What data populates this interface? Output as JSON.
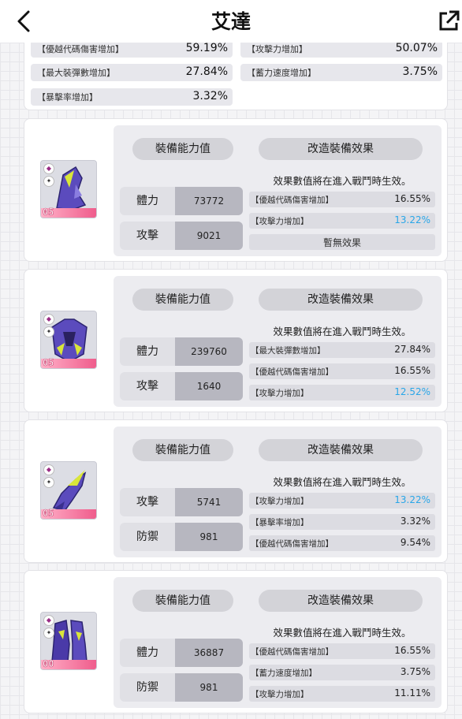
{
  "header": {
    "title": "艾達",
    "back_icon": "chevron-left-icon",
    "share_icon": "external-link-icon"
  },
  "summary": [
    {
      "label": "【優越代碼傷害增加】",
      "value": "59.19%"
    },
    {
      "label": "【攻擊力增加】",
      "value": "50.07%"
    },
    {
      "label": "【最大裝彈數增加】",
      "value": "27.84%"
    },
    {
      "label": "【蓄力速度增加】",
      "value": "3.75%"
    },
    {
      "label": "【暴擊率增加】",
      "value": "3.32%"
    }
  ],
  "ui": {
    "stats_pill": "裝備能力值",
    "effects_pill": "改造裝備效果",
    "effect_note": "效果數值將在進入戰鬥時生效。",
    "none_text": "暫無效果"
  },
  "cards": [
    {
      "level": "05",
      "stats": [
        {
          "key": "體力",
          "value": "73772"
        },
        {
          "key": "攻擊",
          "value": "9021"
        }
      ],
      "effects": [
        {
          "label": "【優越代碼傷害增加】",
          "value": "16.55%",
          "highlight": false
        },
        {
          "label": "【攻擊力增加】",
          "value": "13.22%",
          "highlight": true
        }
      ]
    },
    {
      "level": "05",
      "stats": [
        {
          "key": "體力",
          "value": "239760"
        },
        {
          "key": "攻擊",
          "value": "1640"
        }
      ],
      "effects": [
        {
          "label": "【最大裝彈數增加】",
          "value": "27.84%",
          "highlight": false
        },
        {
          "label": "【優越代碼傷害增加】",
          "value": "16.55%",
          "highlight": false
        },
        {
          "label": "【攻擊力增加】",
          "value": "12.52%",
          "highlight": true
        }
      ]
    },
    {
      "level": "05",
      "stats": [
        {
          "key": "攻擊",
          "value": "5741"
        },
        {
          "key": "防禦",
          "value": "981"
        }
      ],
      "effects": [
        {
          "label": "【攻擊力增加】",
          "value": "13.22%",
          "highlight": true
        },
        {
          "label": "【暴擊率增加】",
          "value": "3.32%",
          "highlight": false
        },
        {
          "label": "【優越代碼傷害增加】",
          "value": "9.54%",
          "highlight": false
        }
      ]
    },
    {
      "level": "00",
      "stats": [
        {
          "key": "體力",
          "value": "36887"
        },
        {
          "key": "防禦",
          "value": "981"
        }
      ],
      "effects": [
        {
          "label": "【優越代碼傷害增加】",
          "value": "16.55%",
          "highlight": false
        },
        {
          "label": "【蓄力速度增加】",
          "value": "3.75%",
          "highlight": false
        },
        {
          "label": "【攻擊力增加】",
          "value": "11.11%",
          "highlight": false
        }
      ]
    }
  ]
}
